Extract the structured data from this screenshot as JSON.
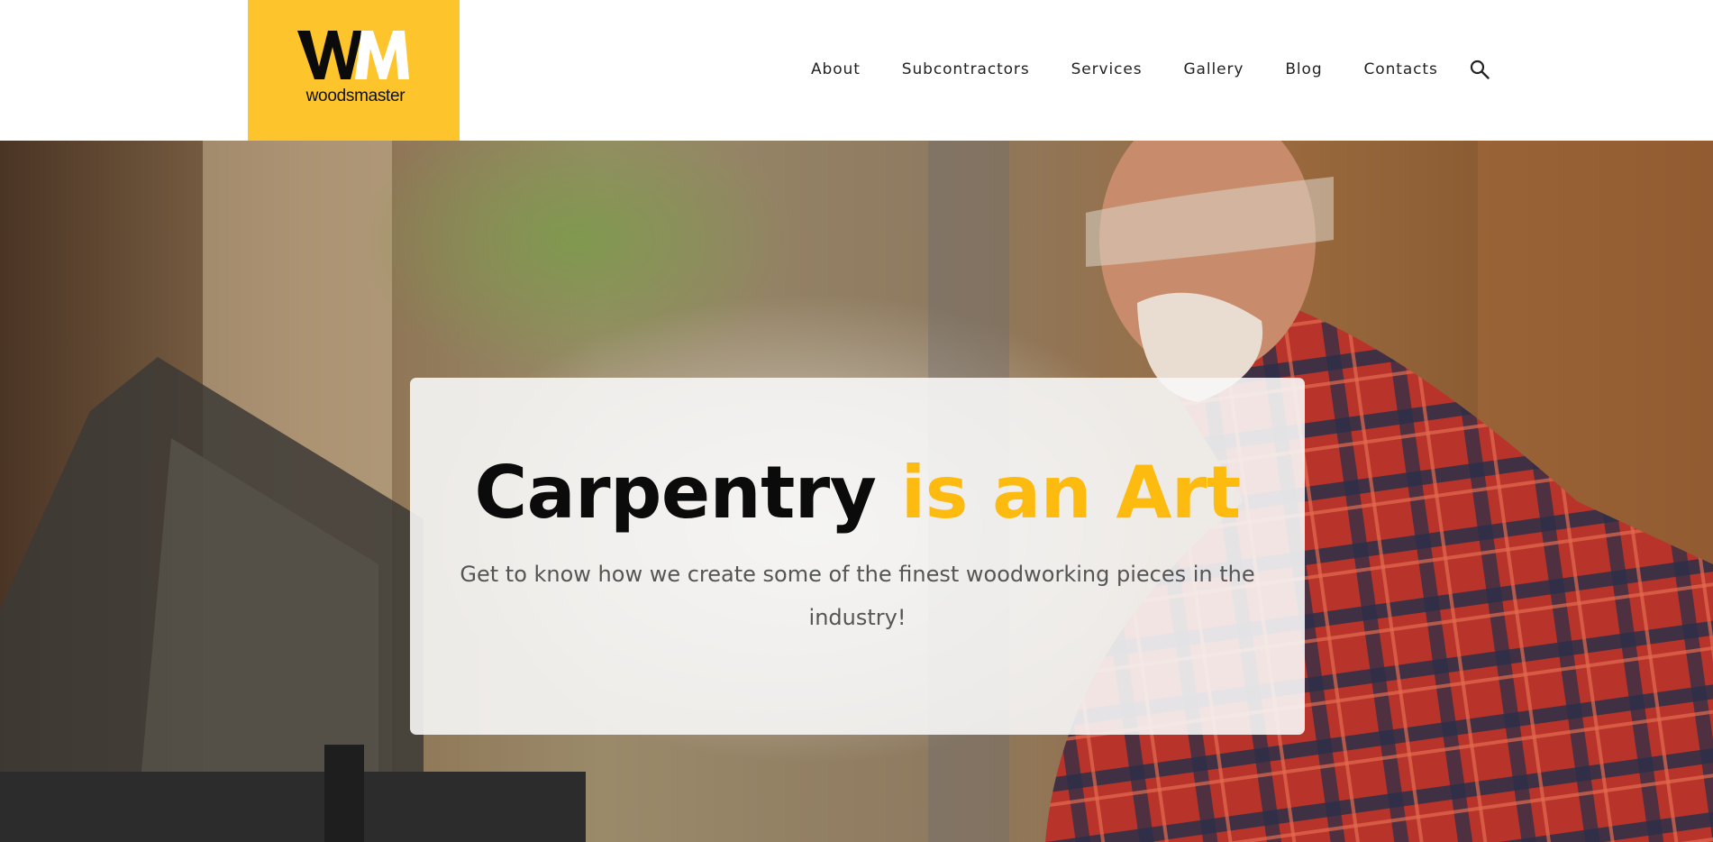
{
  "brand": {
    "logo_text": "woodsmaster",
    "monogram": "WM",
    "accent_color": "#fec42c"
  },
  "nav": {
    "items": [
      {
        "label": "About"
      },
      {
        "label": "Subcontractors"
      },
      {
        "label": "Services"
      },
      {
        "label": "Gallery"
      },
      {
        "label": "Blog"
      },
      {
        "label": "Contacts"
      }
    ],
    "search_icon": "search-icon"
  },
  "hero": {
    "title_main": "Carpentry",
    "title_accent": "is an Art",
    "subtitle": "Get to know how we create some of the finest woodworking pieces in the industry!",
    "title_color": "#0b0b0b",
    "accent_color": "#fdbb0f"
  }
}
